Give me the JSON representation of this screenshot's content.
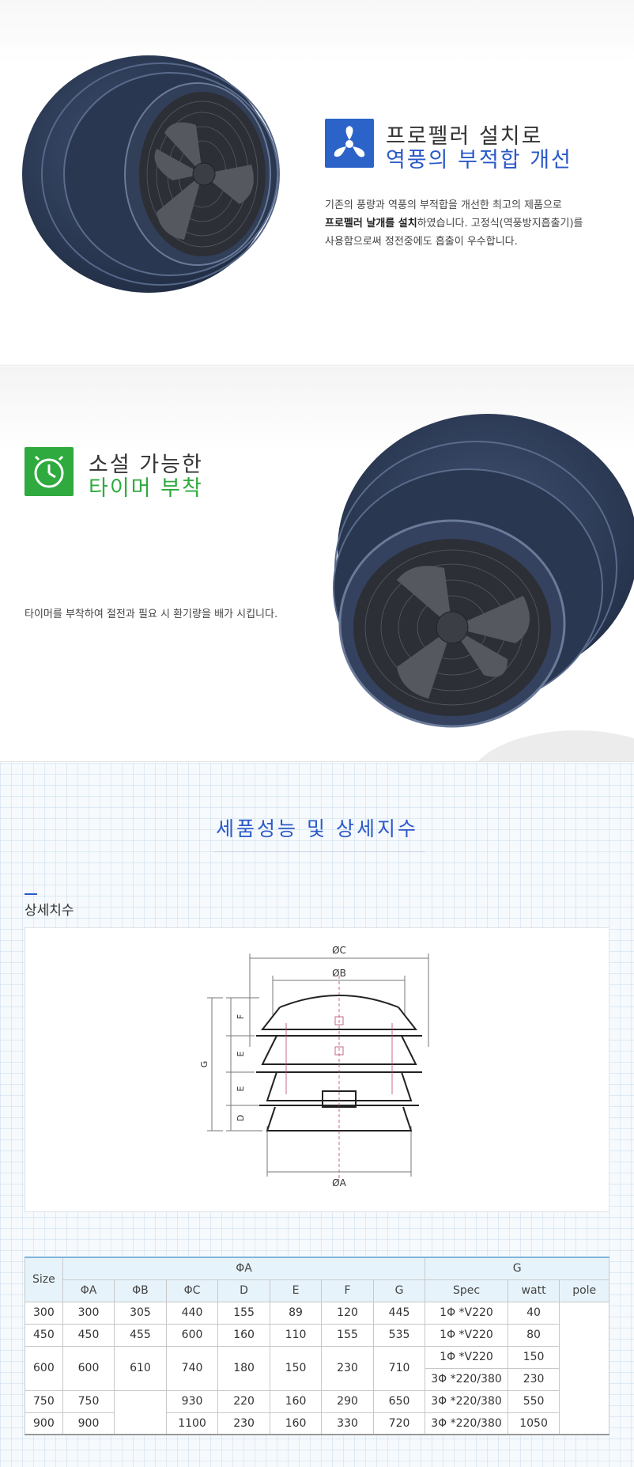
{
  "section1": {
    "heading_line1": "프로펠러 설치로",
    "heading_line2": "역풍의 부적합 개선",
    "para_line1": "기존의 풍량과 역풍의 부적합을 개선한 최고의 제품으로",
    "para_line2_bold": "프로펠러 날개를 설치",
    "para_line2_rest": "하였습니다. 고정식(역풍방지흡출기)를",
    "para_line3": "사용함으로써 정전중에도 흡출이 우수합니다."
  },
  "section2": {
    "heading_line1": "소설 가능한",
    "heading_line2": "타이머 부착",
    "para": "타이머를 부착하여 절전과 필요 시 환기량을 배가 시킵니다."
  },
  "section3": {
    "title": "세품성능 및 상세지수",
    "subtitle": "상세치수"
  },
  "diagram": {
    "label_c": "ØC",
    "label_b": "ØB",
    "label_a": "ØA",
    "label_f": "F",
    "label_e1": "E",
    "label_e2": "E",
    "label_d": "D",
    "label_g": "G"
  },
  "table": {
    "head_size": "Size",
    "group_a": "ΦA",
    "group_g": "G",
    "columns": [
      "ΦA",
      "ΦB",
      "ΦC",
      "D",
      "E",
      "F",
      "G",
      "Spec",
      "watt",
      "pole"
    ],
    "rows": [
      {
        "size": "300",
        "a": "300",
        "b": "305",
        "c": "440",
        "d": "155",
        "e": "89",
        "f": "120",
        "g": "445",
        "spec": "1Φ *V220",
        "watt": "40"
      },
      {
        "size": "450",
        "a": "450",
        "b": "455",
        "c": "600",
        "d": "160",
        "e": "110",
        "f": "155",
        "g": "535",
        "spec": "1Φ *V220",
        "watt": "80"
      },
      {
        "size": "600",
        "a": "600",
        "b": "610",
        "c": "740",
        "d": "180",
        "e": "150",
        "f": "230",
        "g": "710",
        "spec": "1Φ *V220",
        "watt": "150",
        "spec2": "3Φ *220/380",
        "watt2": "230"
      },
      {
        "size": "750",
        "a": "750",
        "b": "",
        "c": "930",
        "d": "220",
        "e": "160",
        "f": "290",
        "g": "650",
        "spec": "3Φ *220/380",
        "watt": "550"
      },
      {
        "size": "900",
        "a": "900",
        "b": "",
        "c": "1100",
        "d": "230",
        "e": "160",
        "f": "330",
        "g": "720",
        "spec": "3Φ *220/380",
        "watt": "1050"
      }
    ]
  },
  "colors": {
    "accent_blue": "#2a59c8",
    "accent_green": "#2fab3e",
    "fan_body": "#2b3a55"
  }
}
